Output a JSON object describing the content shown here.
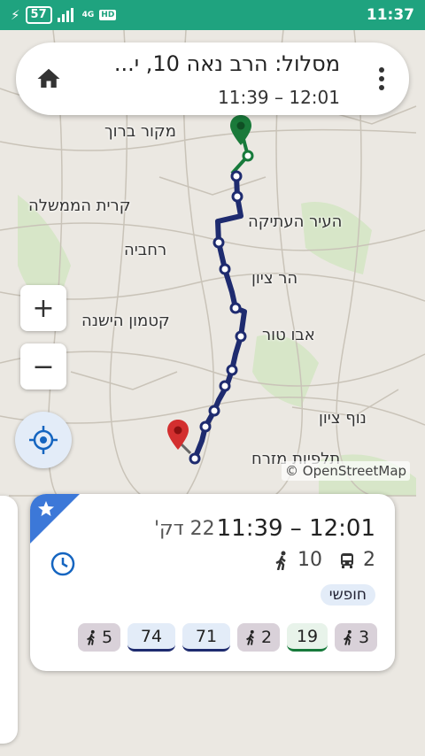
{
  "status_bar": {
    "battery": "57",
    "network": "4G",
    "hd": "HD",
    "time": "11:37"
  },
  "header": {
    "title": "מסלול: הרב נאה 10, י...",
    "time_range": "11:39 – 12:01"
  },
  "map": {
    "labels": [
      {
        "id": "mekor-baruch",
        "text": "מקור ברוך"
      },
      {
        "id": "kiryat-hamemshala",
        "text": "קרית הממשלה"
      },
      {
        "id": "old-city",
        "text": "העיר העתיקה"
      },
      {
        "id": "rehavia",
        "text": "רחביה"
      },
      {
        "id": "mount-zion",
        "text": "הר ציון"
      },
      {
        "id": "old-katamon",
        "text": "קטמון הישנה"
      },
      {
        "id": "abu-tor",
        "text": "אבו טור"
      },
      {
        "id": "nof-zion",
        "text": "נוף ציון"
      },
      {
        "id": "talpiot-mizrah",
        "text": "תלפיות מזרח"
      }
    ],
    "attribution": "© OpenStreetMap",
    "route_color": "#1e2b6f",
    "walk_color": "#177a3b",
    "origin_pin_color": "#1a7a3a",
    "dest_pin_color": "#d32f2f"
  },
  "controls": {
    "zoom_in": "+",
    "zoom_out": "−"
  },
  "card": {
    "time_range": "11:39 – 12:01",
    "duration": "22 דק'",
    "walk_minutes": "10",
    "bus_count": "2",
    "free_label": "חופשי",
    "legs": [
      {
        "type": "walk",
        "value": "5"
      },
      {
        "type": "bus",
        "value": "74"
      },
      {
        "type": "bus",
        "value": "71"
      },
      {
        "type": "walk",
        "value": "2"
      },
      {
        "type": "bus",
        "value": "19"
      },
      {
        "type": "walk",
        "value": "3"
      }
    ]
  }
}
